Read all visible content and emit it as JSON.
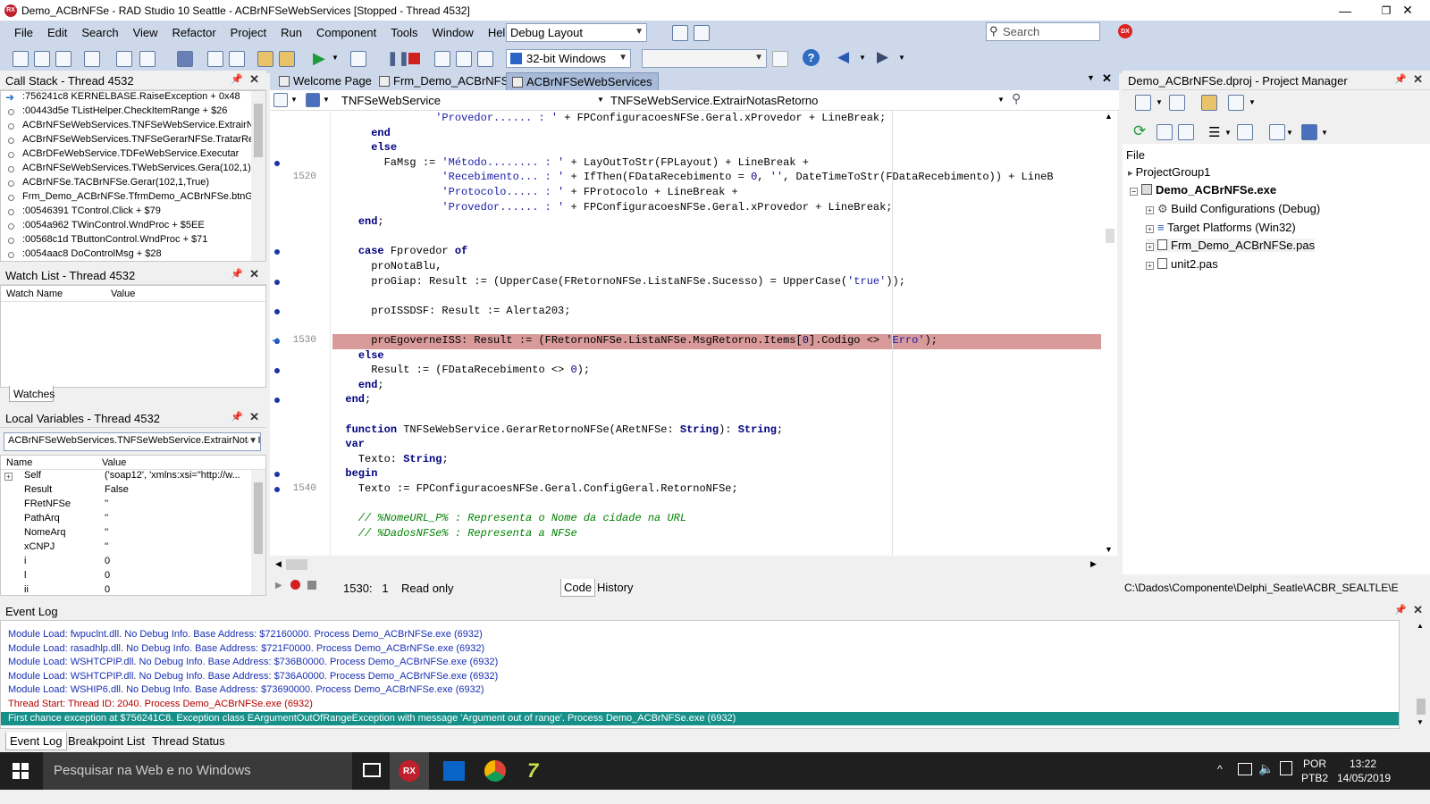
{
  "window": {
    "title": "Demo_ACBrNFSe - RAD Studio 10 Seattle - ACBrNFSeWebServices [Stopped - Thread 4532]",
    "app_icon": "RX",
    "minimize": "—",
    "maximize": "❐",
    "close": "✕"
  },
  "menu": [
    "File",
    "Edit",
    "Search",
    "View",
    "Refactor",
    "Project",
    "Run",
    "Component",
    "Tools",
    "Window",
    "Help"
  ],
  "toolbar": {
    "layout_combo": "Debug Layout",
    "platform_combo": "32-bit Windows",
    "search_placeholder": "Search"
  },
  "call_stack": {
    "title": "Call Stack - Thread 4532",
    "rows": [
      ":756241c8 KERNELBASE.RaiseException + 0x48",
      ":00443d5e TListHelper.CheckItemRange + $26",
      "ACBrNFSeWebServices.TNFSeWebService.ExtrairNot",
      "ACBrNFSeWebServices.TNFSeGerarNFSe.TratarResp",
      "ACBrDFeWebService.TDFeWebService.Executar",
      "ACBrNFSeWebServices.TWebServices.Gera(102,1)",
      "ACBrNFSe.TACBrNFSe.Gerar(102,1,True)",
      "Frm_Demo_ACBrNFSe.TfrmDemo_ACBrNFSe.btnGera",
      ":00546391 TControl.Click + $79",
      ":0054a962 TWinControl.WndProc + $5EE",
      ":00568c1d TButtonControl.WndProc + $71",
      ":0054aac8 DoControlMsg + $28"
    ]
  },
  "watch_list": {
    "title": "Watch List - Thread 4532",
    "col_name": "Watch Name",
    "col_value": "Value",
    "tab": "Watches"
  },
  "local_vars": {
    "title": "Local Variables - Thread 4532",
    "combo": "ACBrNFSeWebServices.TNFSeWebService.ExtrairNotasI",
    "col_name": "Name",
    "col_value": "Value",
    "rows": [
      {
        "name": "Self",
        "value": "('soap12', 'xmlns:xsi=\"http://w..."
      },
      {
        "name": "Result",
        "value": "False"
      },
      {
        "name": "FRetNFSe",
        "value": "''"
      },
      {
        "name": "PathArq",
        "value": "''"
      },
      {
        "name": "NomeArq",
        "value": "''"
      },
      {
        "name": "xCNPJ",
        "value": "''"
      },
      {
        "name": "i",
        "value": "0"
      },
      {
        "name": "l",
        "value": "0"
      },
      {
        "name": "ii",
        "value": "0"
      }
    ]
  },
  "editor": {
    "tabs": [
      "Welcome Page",
      "Frm_Demo_ACBrNFSe",
      "ACBrNFSeWebServices"
    ],
    "class_combo": "TNFSeWebService",
    "method_combo": "TNFSeWebService.ExtrairNotasRetorno",
    "line_numbers": [
      "1520",
      "1530",
      "1540"
    ],
    "cursor_pos": "1530:   1",
    "mode": "Read only",
    "view_tabs": [
      "Code",
      "History"
    ],
    "code_lines": [
      "                'Provedor...... : ' + FPConfiguracoesNFSe.Geral.xProvedor + LineBreak;",
      "      end",
      "      else",
      "        FaMsg := 'Método........ : ' + LayOutToStr(FPLayout) + LineBreak +",
      "                 'Recebimento... : ' + IfThen(FDataRecebimento = 0, '', DateTimeToStr(FDataRecebimento)) + LineB",
      "                 'Protocolo..... : ' + FProtocolo + LineBreak +",
      "                 'Provedor...... : ' + FPConfiguracoesNFSe.Geral.xProvedor + LineBreak;",
      "    end;",
      "",
      "    case Fprovedor of",
      "      proNotaBlu,",
      "      proGiap: Result := (UpperCase(FRetornoNFSe.ListaNFSe.Sucesso) = UpperCase('true'));",
      "",
      "      proISSDSF: Result := Alerta203;",
      "",
      "      proEgoverneISS: Result := (FRetornoNFSe.ListaNFSe.MsgRetorno.Items[0].Codigo <> 'Erro');",
      "    else",
      "      Result := (FDataRecebimento <> 0);",
      "    end;",
      "  end;",
      "",
      "  function TNFSeWebService.GerarRetornoNFSe(ARetNFSe: String): String;",
      "  var",
      "    Texto: String;",
      "  begin",
      "    Texto := FPConfiguracoesNFSe.Geral.ConfigGeral.RetornoNFSe;",
      "",
      "    // %NomeURL_P% : Representa o Nome da cidade na URL",
      "    // %DadosNFSe% : Representa a NFSe"
    ]
  },
  "project_manager": {
    "title": "Demo_ACBrNFSe.dproj - Project Manager",
    "file_label": "File",
    "items": [
      "ProjectGroup1",
      "Demo_ACBrNFSe.exe",
      "Build Configurations (Debug)",
      "Target Platforms (Win32)",
      "Frm_Demo_ACBrNFSe.pas",
      "unit2.pas"
    ],
    "path": "C:\\Dados\\Componente\\Delphi_Seatle\\ACBR_SEALTLE\\E"
  },
  "event_log": {
    "title": "Event Log",
    "rows": [
      "Module Load: fwpuclnt.dll. No Debug Info. Base Address: $72160000. Process Demo_ACBrNFSe.exe (6932)",
      "Module Load: rasadhlp.dll. No Debug Info. Base Address: $721F0000. Process Demo_ACBrNFSe.exe (6932)",
      "Module Load: WSHTCPIP.dll. No Debug Info. Base Address: $736B0000. Process Demo_ACBrNFSe.exe (6932)",
      "Module Load: WSHTCPIP.dll. No Debug Info. Base Address: $736A0000. Process Demo_ACBrNFSe.exe (6932)",
      "Module Load: WSHIP6.dll. No Debug Info. Base Address: $73690000. Process Demo_ACBrNFSe.exe (6932)",
      "Thread Start: Thread ID: 2040. Process Demo_ACBrNFSe.exe (6932)",
      "First chance exception at $756241C8. Exception class EArgumentOutOfRangeException with message 'Argument out of range'. Process Demo_ACBrNFSe.exe (6932)"
    ],
    "tabs": [
      "Event Log",
      "Breakpoint List",
      "Thread Status"
    ]
  },
  "taskbar": {
    "search_placeholder": "Pesquisar na Web e no Windows",
    "lang": "POR",
    "layout": "PTB2",
    "time": "13:22",
    "date": "14/05/2019"
  },
  "colors": {
    "chrome_blue": "#cdd9ea",
    "exec_line": "#d99a9a",
    "event_selected": "#17908a",
    "event_text": "#1a30b3",
    "event_red": "#b30000"
  }
}
